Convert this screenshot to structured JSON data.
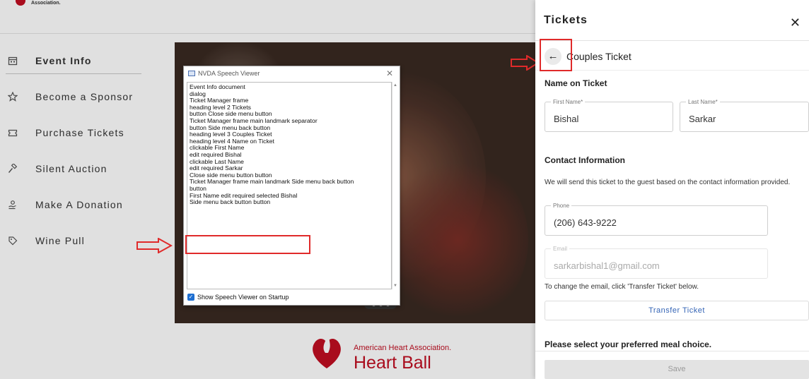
{
  "header": {
    "logo_text": "Association."
  },
  "sidebar": {
    "items": [
      {
        "label": "Event Info",
        "icon": "calendar-icon"
      },
      {
        "label": "Become a Sponsor",
        "icon": "star-icon"
      },
      {
        "label": "Purchase Tickets",
        "icon": "ticket-icon"
      },
      {
        "label": "Silent Auction",
        "icon": "gavel-icon"
      },
      {
        "label": "Make A Donation",
        "icon": "donate-hand-icon"
      },
      {
        "label": "Wine Pull",
        "icon": "tag-icon"
      }
    ]
  },
  "footer_logo": {
    "line1": "American Heart Association.",
    "line2": "Heart Ball"
  },
  "nvda": {
    "title": "NVDA Speech Viewer",
    "lines": [
      "Event Info  document",
      "dialog",
      "Ticket Manager  frame",
      "heading   level 2  Tickets",
      "button   Close side menu button",
      "Ticket Manager  frame   main landmark   separator",
      "button   Side menu back button",
      "heading   level 3  Couples Ticket",
      "heading   level 4  Name on Ticket",
      "clickable  First Name",
      "edit  required   Bishal",
      "clickable  Last Name",
      "edit  required   Sarkar",
      "Close side menu button  button",
      "Ticket Manager  frame   main landmark   Side menu back button",
      "button",
      "First Name  edit  required  selected  Bishal",
      "Side menu back button  button"
    ],
    "checkbox_label": "Show Speech Viewer on Startup"
  },
  "panel": {
    "title": "Tickets",
    "subtitle": "Couples Ticket",
    "name_section": "Name on Ticket",
    "first_name": {
      "label": "First Name*",
      "value": "Bishal"
    },
    "last_name": {
      "label": "Last Name*",
      "value": "Sarkar"
    },
    "contact_section": "Contact Information",
    "contact_note": "We will send this ticket to the guest based on the contact information provided.",
    "phone": {
      "label": "Phone",
      "value": "(206) 643-9222"
    },
    "email": {
      "label": "Email",
      "value": "sarkarbishal1@gmail.com"
    },
    "email_note": "To change the email, click 'Transfer Ticket' below.",
    "transfer_button": "Transfer Ticket",
    "meal_section": "Please select your preferred meal choice.",
    "save_button": "Save"
  },
  "colors": {
    "brand_red": "#c10e21",
    "link_blue": "#3565b6",
    "annotation_red": "#e02a2a"
  }
}
